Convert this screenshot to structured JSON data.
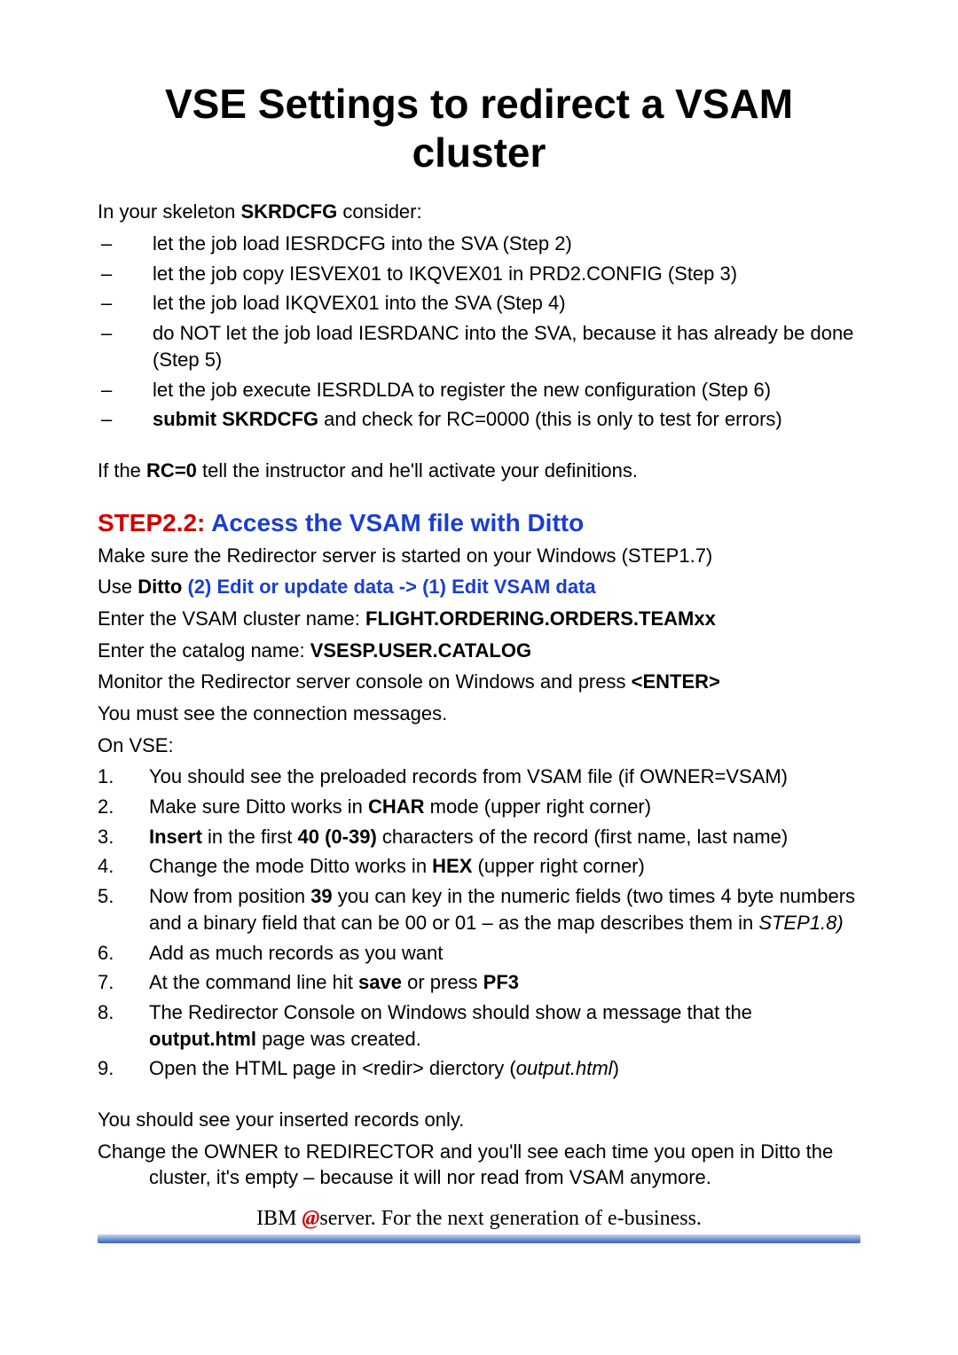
{
  "title": "VSE Settings to redirect a VSAM cluster",
  "intro_prefix": "In your skeleton ",
  "intro_bold": "SKRDCFG",
  "intro_suffix": " consider:",
  "dashes": [
    {
      "plain": "let the job load IESRDCFG into the SVA (Step 2)"
    },
    {
      "plain": "let the job copy IESVEX01 to IKQVEX01 in PRD2.CONFIG (Step 3)"
    },
    {
      "plain": "let the job load IKQVEX01 into the SVA (Step 4)"
    },
    {
      "plain": "do NOT let the job load IESRDANC into the SVA, because it has already be done (Step 5)"
    },
    {
      "plain": "let the job execute IESRDLDA to register the new configuration (Step 6)"
    },
    {
      "bold": "submit SKRDCFG",
      "rest": " and check for RC=0000 (this is only to test for errors)"
    }
  ],
  "rc_prefix": "If  the ",
  "rc_bold": "RC=0",
  "rc_suffix": " tell the instructor and he'll activate your definitions.",
  "step22_label": "STEP2.2:",
  "step22_title": " Access the VSAM file with Ditto",
  "line_make_sure": "Make sure the Redirector server is started on your Windows (STEP1.7)",
  "use_prefix": "Use ",
  "use_ditto": "Ditto",
  "use_blue": "  (2) Edit or update data -> (1) Edit VSAM data",
  "enter_cluster_prefix": "Enter the VSAM cluster name: ",
  "enter_cluster_bold": "FLIGHT.ORDERING.ORDERS.TEAMxx",
  "enter_catalog_prefix": "Enter the catalog name: ",
  "enter_catalog_bold": "VSESP.USER.CATALOG",
  "monitor_prefix": "Monitor the Redirector server console on Windows and press ",
  "monitor_bold": "<ENTER>",
  "must_see": "You must see the connection messages.",
  "on_vse": "On VSE:",
  "nums": [
    {
      "n": "1.",
      "parts": [
        {
          "t": "You should see the preloaded records from VSAM file (if OWNER=VSAM)"
        }
      ]
    },
    {
      "n": "2.",
      "parts": [
        {
          "t": "Make sure Ditto works in "
        },
        {
          "b": "CHAR"
        },
        {
          "t": " mode (upper right corner)"
        }
      ]
    },
    {
      "n": "3.",
      "parts": [
        {
          "t": " "
        },
        {
          "b": "Insert"
        },
        {
          "t": " in the first "
        },
        {
          "b": "40 (0-39)"
        },
        {
          "t": " characters of the record (first name, last name)"
        }
      ]
    },
    {
      "n": "4.",
      "parts": [
        {
          "t": "Change the mode Ditto works in "
        },
        {
          "b": "HEX"
        },
        {
          "t": " (upper right corner)"
        }
      ]
    },
    {
      "n": "5.",
      "parts": [
        {
          "t": "Now from position "
        },
        {
          "b": "39"
        },
        {
          "t": " you can key in the numeric fields (two times 4 byte numbers and a binary field that can be 00 or 01 – as the map describes them in "
        },
        {
          "i": "STEP1.8)"
        }
      ]
    },
    {
      "n": "6.",
      "parts": [
        {
          "t": "Add as much records as you want"
        }
      ]
    },
    {
      "n": "7.",
      "parts": [
        {
          "t": "At the command line hit "
        },
        {
          "b": "save"
        },
        {
          "t": " or press "
        },
        {
          "b": "PF3"
        }
      ]
    },
    {
      "n": "8.",
      "parts": [
        {
          "t": "The Redirector Console on Windows should show a message that the "
        },
        {
          "b": "output.html"
        },
        {
          "t": " page was  created."
        }
      ]
    },
    {
      "n": "9.",
      "parts": [
        {
          "t": "Open the HTML page in <redir> dierctory ("
        },
        {
          "i": "output.html"
        },
        {
          "t": ")"
        }
      ]
    }
  ],
  "closing1": "You should see your inserted records only.",
  "closing2": "Change the OWNER to REDIRECTOR and you'll see each time you open in Ditto the cluster, it's empty – because it will nor read from VSAM anymore.",
  "footer_ibm": "IBM ",
  "footer_at": "@",
  "footer_server": "server.",
  "footer_rest": "  For the next generation of e-business."
}
